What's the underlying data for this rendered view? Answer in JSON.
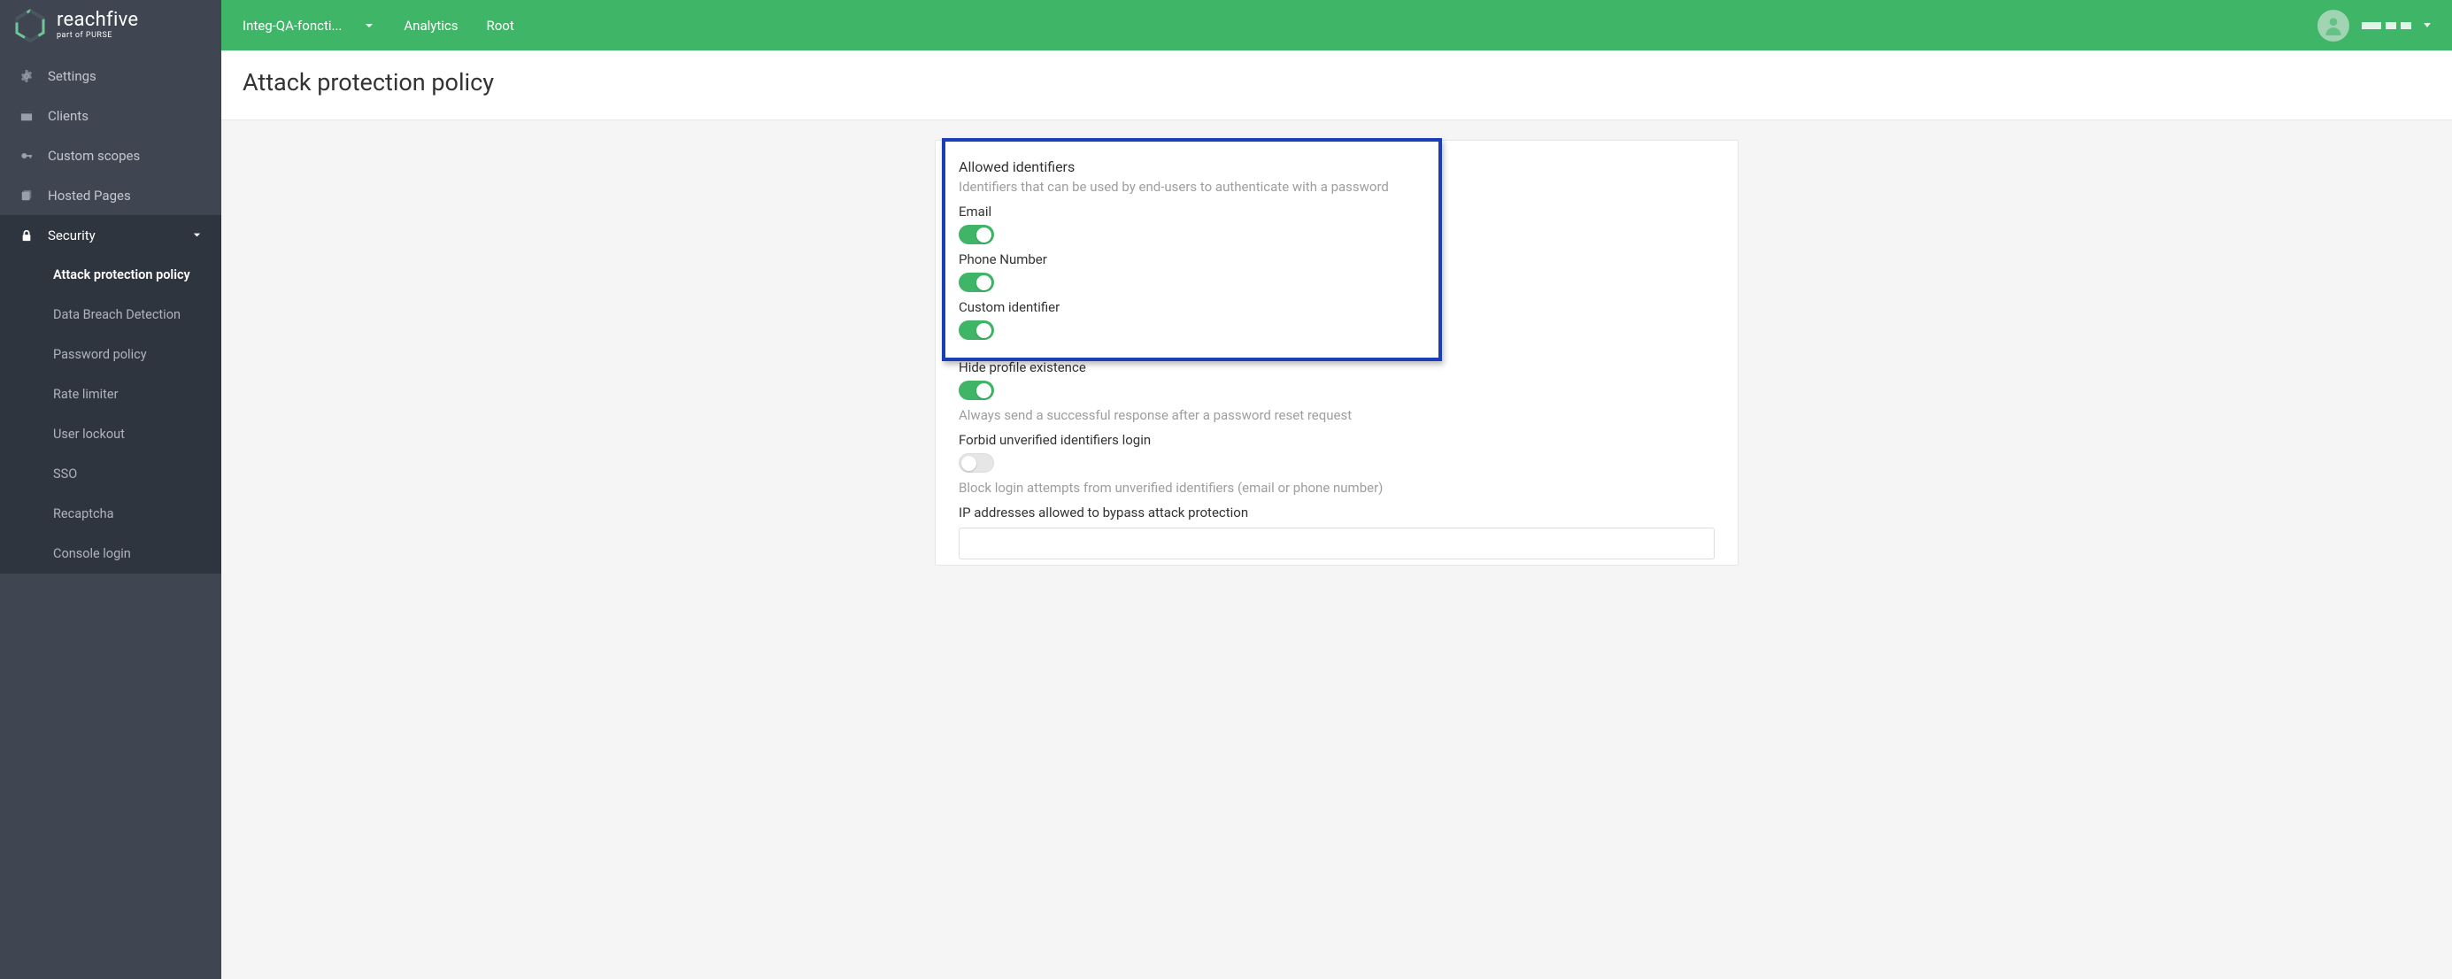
{
  "brand": {
    "name": "reachfive",
    "sub": "part of PURSE"
  },
  "topbar": {
    "tenant": "Integ-QA-foncti...",
    "links": [
      "Analytics",
      "Root"
    ]
  },
  "sidebar": {
    "items": [
      {
        "icon": "gear",
        "label": "Settings"
      },
      {
        "icon": "panel",
        "label": "Clients"
      },
      {
        "icon": "key",
        "label": "Custom scopes"
      },
      {
        "icon": "pages",
        "label": "Hosted Pages"
      },
      {
        "icon": "lock",
        "label": "Security",
        "expanded": true
      }
    ],
    "security_sub": [
      "Attack protection policy",
      "Data Breach Detection",
      "Password policy",
      "Rate limiter",
      "User lockout",
      "SSO",
      "Recaptcha",
      "Console login"
    ]
  },
  "page": {
    "title": "Attack protection policy"
  },
  "form": {
    "allowed_identifiers": {
      "title": "Allowed identifiers",
      "desc": "Identifiers that can be used by end-users to authenticate with a password",
      "email": {
        "label": "Email",
        "on": true
      },
      "phone": {
        "label": "Phone Number",
        "on": true
      },
      "custom": {
        "label": "Custom identifier",
        "on": true
      }
    },
    "hide_profile": {
      "label": "Hide profile existence",
      "on": true,
      "desc": "Always send a successful response after a password reset request"
    },
    "forbid_unverified": {
      "label": "Forbid unverified identifiers login",
      "on": false,
      "desc": "Block login attempts from unverified identifiers (email or phone number)"
    },
    "ip_bypass": {
      "label": "IP addresses allowed to bypass attack protection"
    }
  }
}
